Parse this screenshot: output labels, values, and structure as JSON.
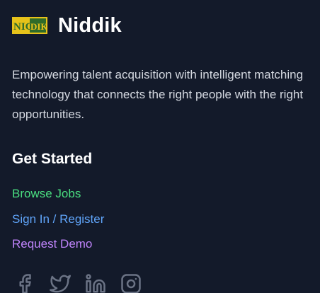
{
  "brand": {
    "name": "Niddik",
    "logo_text_left": "NIC",
    "logo_text_right": "DIK"
  },
  "tagline": "Empowering talent acquisition with intelligent matching technology that connects the right people with the right opportunities.",
  "get_started": {
    "title": "Get Started",
    "links": [
      {
        "label": "Browse Jobs",
        "color": "#4ade80"
      },
      {
        "label": "Sign In / Register",
        "color": "#60a5fa"
      },
      {
        "label": "Request Demo",
        "color": "#c084fc"
      }
    ]
  },
  "social": [
    {
      "icon": "facebook-icon"
    },
    {
      "icon": "twitter-icon"
    },
    {
      "icon": "linkedin-icon"
    },
    {
      "icon": "instagram-icon"
    }
  ],
  "colors": {
    "background": "#131a2a",
    "icon": "#6b7385",
    "logo_yellow": "#e6c21a",
    "logo_green": "#2f6b2a"
  }
}
